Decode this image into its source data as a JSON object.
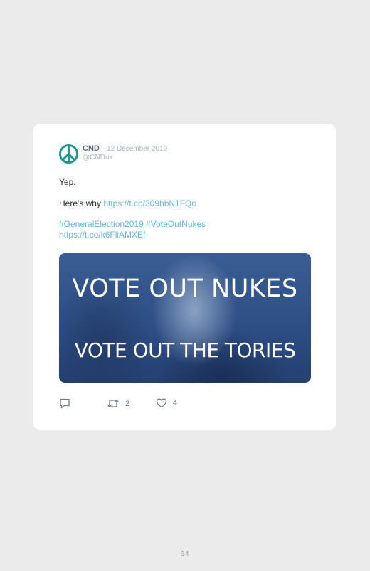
{
  "tweet": {
    "author_name": "CND",
    "date": "· 12 December 2019",
    "handle": "@CNDuk",
    "line1": "Yep.",
    "line2_prefix": "Here's why ",
    "line2_link": "https://t.co/309hbN1FQo",
    "hashtag1": "#GeneralElection2019",
    "hashtag2": "#VoteOutNukes",
    "link2": "https://t.co/k6FliAMXEf",
    "image_text_top": "VOTE OUT NUKES",
    "image_text_bottom": "VOTE OUT THE TORIES",
    "retweet_count": "2",
    "like_count": "4"
  },
  "page": {
    "number": "64"
  },
  "colors": {
    "link": "#64b8dd",
    "avatar": "#1a9a8a",
    "media_tint": "#2d4f86"
  },
  "icons": [
    "peace-icon",
    "reply-icon",
    "retweet-icon",
    "like-icon"
  ]
}
